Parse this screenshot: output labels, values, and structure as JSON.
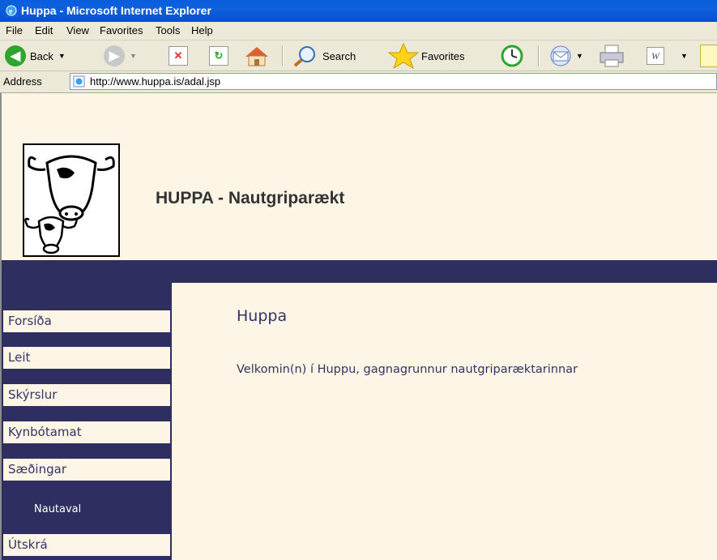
{
  "window": {
    "title": "Huppa - Microsoft Internet Explorer"
  },
  "menu": {
    "items": [
      "File",
      "Edit",
      "View",
      "Favorites",
      "Tools",
      "Help"
    ]
  },
  "toolbar": {
    "back_label": "Back",
    "search_label": "Search",
    "favorites_label": "Favorites"
  },
  "address": {
    "label": "Address",
    "url": "http://www.huppa.is/adal.jsp"
  },
  "site": {
    "title": "HUPPA - Nautgriparækt"
  },
  "nav": {
    "items": [
      {
        "label": "Forsíða"
      },
      {
        "label": "Leit"
      },
      {
        "label": "Skýrslur"
      },
      {
        "label": "Kynbótamat"
      },
      {
        "label": "Sæðingar"
      },
      {
        "label": "Útskrá"
      }
    ],
    "subitem": "Nautaval"
  },
  "content": {
    "heading": "Huppa",
    "welcome": "Velkomin(n) í Huppu, gagnagrunnur nautgriparæktarinnar"
  },
  "colors": {
    "nav_dark": "#2e2e60",
    "page_bg": "#fdf5e6",
    "titlebar_blue": "#0450d6"
  }
}
